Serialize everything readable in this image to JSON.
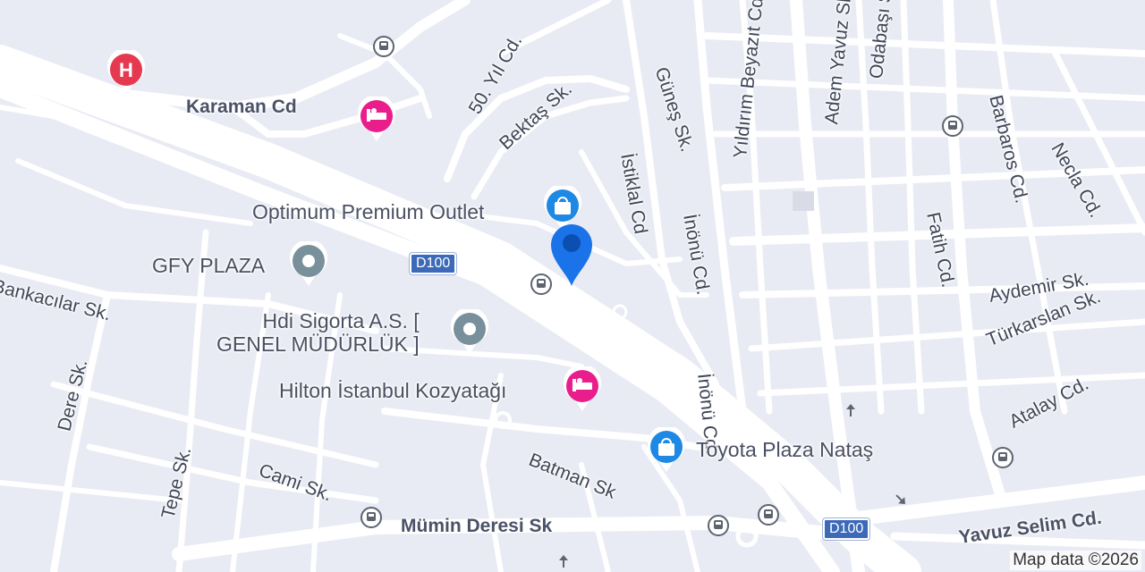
{
  "streets": {
    "karaman": "Karaman Cd",
    "yil50": "50. Yıl Cd.",
    "bektas": "Bektaş Sk.",
    "gunes": "Güneş Sk.",
    "istiklal": "İstiklal Cd",
    "inonu1": "İnönü Cd.",
    "inonu2": "İnönü Cd.",
    "yildirim": "Yıldırım Beyazıt Cd.",
    "adem": "Adem Yavuz Sk.",
    "odabasi": "Odabaşı Sk.",
    "fatih": "Fatih Cd.",
    "barbaros": "Barbaros Cd.",
    "necla": "Necla Cd.",
    "aydemir": "Aydemir Sk.",
    "turkarslan": "Türkarslan Sk.",
    "atalay": "Atalay Cd.",
    "yavuz": "Yavuz Selim Cd.",
    "bankacilar": "Bankacılar Sk.",
    "dere": "Dere Sk.",
    "tepe": "Tepe Sk.",
    "cami": "Cami Sk.",
    "batman": "Batman Sk",
    "mumin": "Mümin Deresi Sk"
  },
  "pois": {
    "optimum": "Optimum Premium Outlet",
    "gfy": "GFY PLAZA",
    "hdi_line1": "Hdi Sigorta A.S. [",
    "hdi_line2": "GENEL MÜDÜRLÜK ]",
    "hilton": "Hilton İstanbul Kozyatağı",
    "toyota": "Toyota Plaza Nataş"
  },
  "shields": {
    "d100_a": "D100",
    "d100_b": "D100"
  },
  "hospital_letter": "H",
  "copyright": "Map data ©2026",
  "colors": {
    "background": "#e9ebf4",
    "road": "#ffffff",
    "pin": "#1a73e8",
    "shopping": "#1e88e5",
    "hotel": "#e91e8c",
    "hospital": "#e53950",
    "landmark": "#78909c"
  }
}
